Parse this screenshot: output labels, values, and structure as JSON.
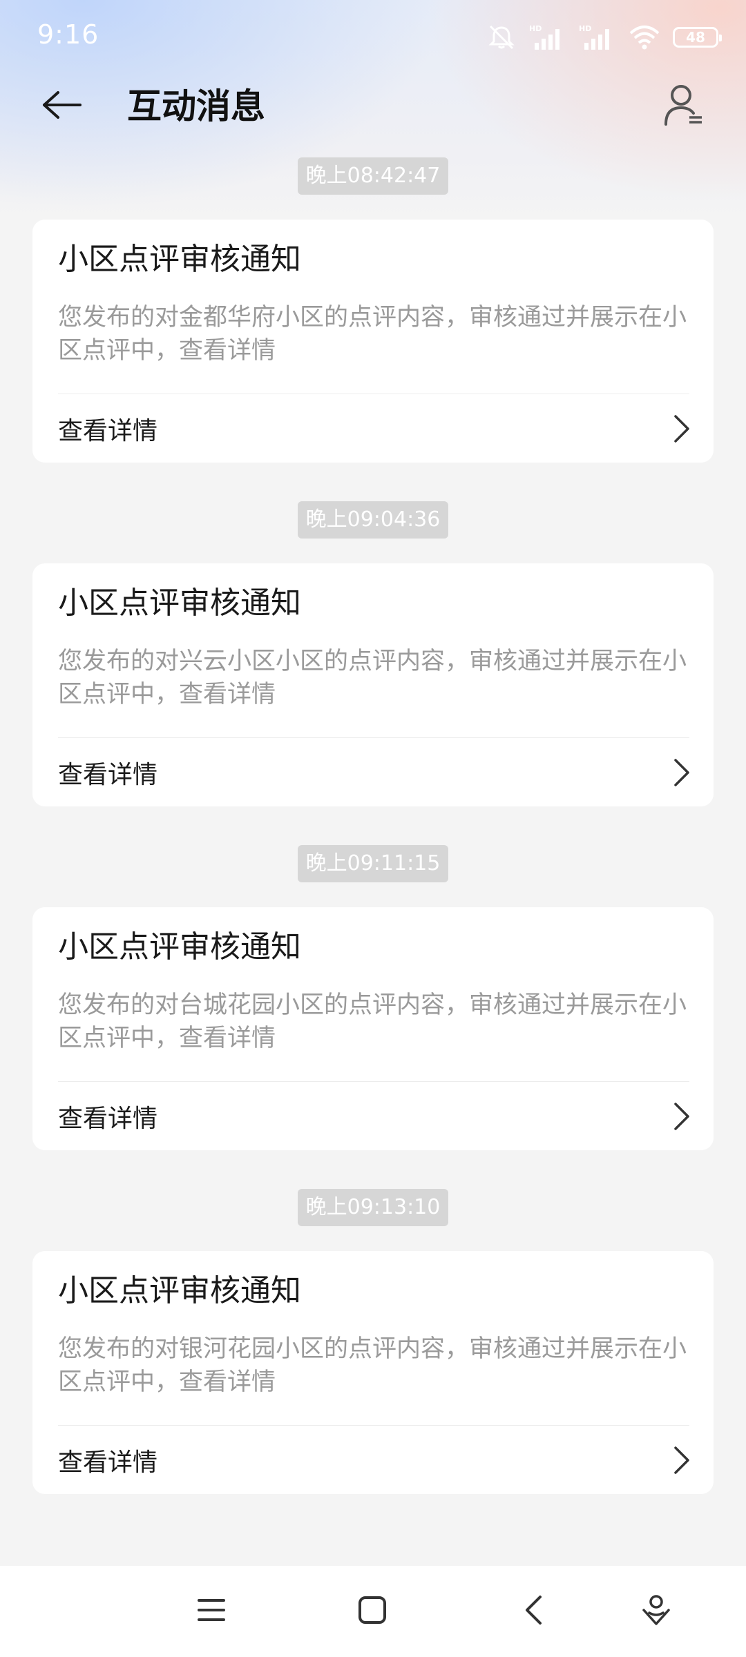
{
  "status_bar": {
    "time": "9:16",
    "battery": "48",
    "icons": [
      "mute-icon",
      "signal-hd-icon",
      "signal-hd-icon",
      "wifi-icon",
      "battery-icon"
    ]
  },
  "header": {
    "title": "互动消息",
    "back_icon": "back-arrow-icon",
    "profile_icon": "user-settings-icon"
  },
  "messages": [
    {
      "time": "晚上08:42:47",
      "title": "小区点评审核通知",
      "desc": "您发布的对金都华府小区的点评内容，审核通过并展示在小区点评中，查看详情",
      "link": "查看详情"
    },
    {
      "time": "晚上09:04:36",
      "title": "小区点评审核通知",
      "desc": "您发布的对兴云小区小区的点评内容，审核通过并展示在小区点评中，查看详情",
      "link": "查看详情"
    },
    {
      "time": "晚上09:11:15",
      "title": "小区点评审核通知",
      "desc": "您发布的对台城花园小区的点评内容，审核通过并展示在小区点评中，查看详情",
      "link": "查看详情"
    },
    {
      "time": "晚上09:13:10",
      "title": "小区点评审核通知",
      "desc": "您发布的对银河花园小区的点评内容，审核通过并展示在小区点评中，查看详情",
      "link": "查看详情"
    }
  ],
  "nav_bar": {
    "icons": [
      "menu-icon",
      "home-square-icon",
      "back-chevron-icon",
      "assistant-icon"
    ]
  },
  "colors": {
    "background": "#f4f4f4",
    "card": "#ffffff",
    "time_pill": "#d6d6d6",
    "desc_text": "#9a9a9a"
  }
}
